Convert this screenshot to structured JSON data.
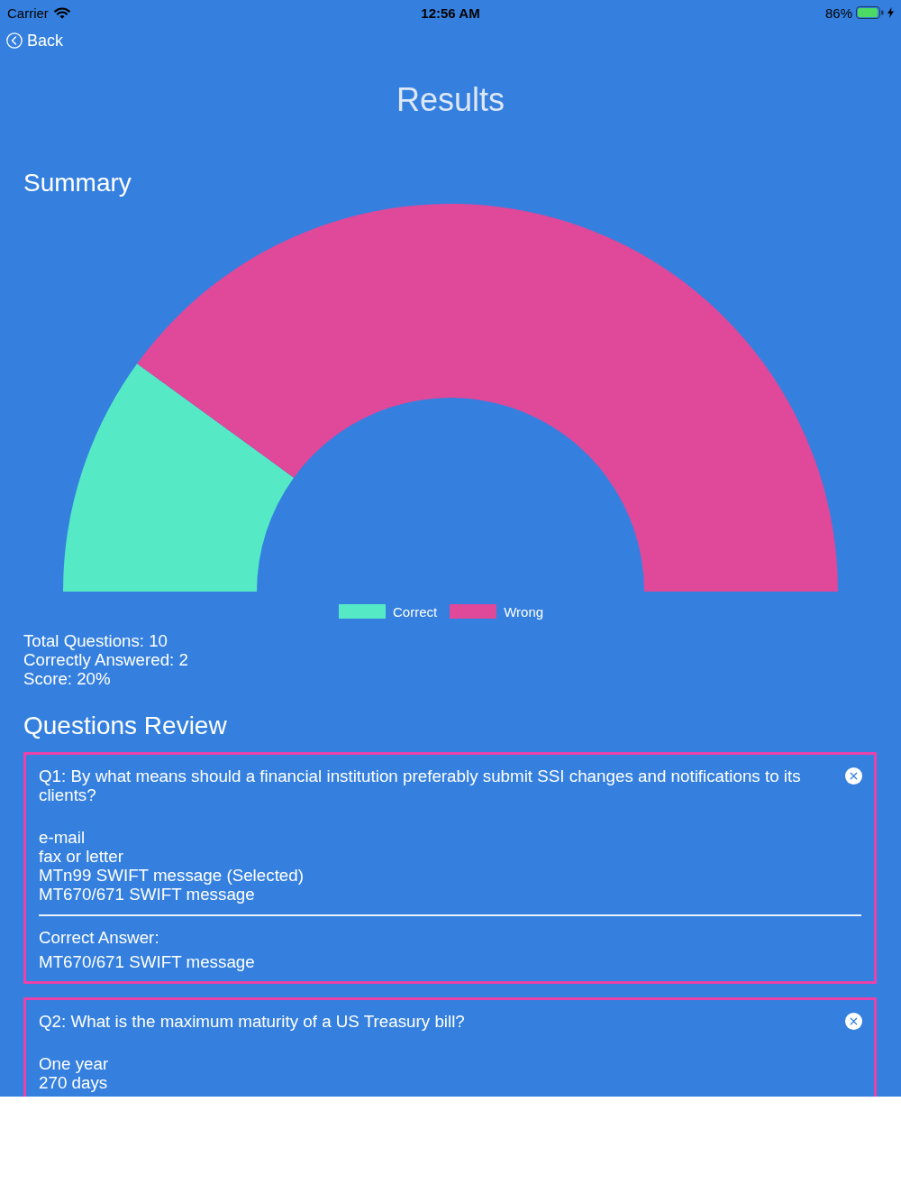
{
  "status_bar": {
    "carrier": "Carrier",
    "time": "12:56 AM",
    "battery": "86%"
  },
  "nav": {
    "back": "Back"
  },
  "title": "Results",
  "summary": {
    "heading": "Summary",
    "chart_data": {
      "type": "donut",
      "categories": [
        "Correct",
        "Wrong"
      ],
      "values": [
        20,
        80
      ]
    },
    "legend": [
      {
        "color": "#55eac5"
      },
      {
        "color": "#e0489a"
      }
    ],
    "stats": [
      "Total Questions: 10",
      "Correctly Answered: 2",
      "Score: 20%"
    ]
  },
  "review": {
    "heading": "Questions Review",
    "questions": [
      {
        "question": "Q1: By what means should a financial institution preferably submit SSI changes and notifications to its clients?",
        "correct": false,
        "options": [
          "e-mail",
          "fax or letter",
          "MTn99 SWIFT message (Selected)",
          "MT670/671 SWIFT message"
        ],
        "correct_label": "Correct Answer:",
        "correct_answer": "MT670/671 SWIFT message"
      },
      {
        "question": "Q2: What is the maximum maturity of a US Treasury bill?",
        "correct": false,
        "options": [
          "One year",
          "270 days"
        ]
      }
    ]
  }
}
